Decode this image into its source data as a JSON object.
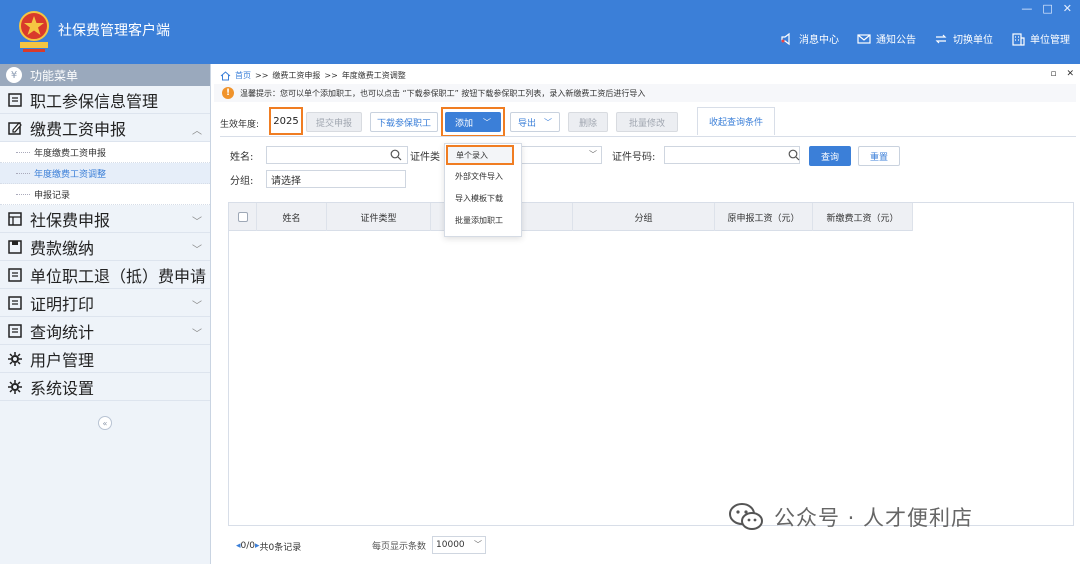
{
  "app": {
    "title": "社保费管理客户端"
  },
  "window_controls": [
    "—",
    "□",
    "✕"
  ],
  "top_nav": [
    {
      "label": "消息中心",
      "icon": "speaker-icon"
    },
    {
      "label": "通知公告",
      "icon": "mail-icon"
    },
    {
      "label": "切换单位",
      "icon": "switch-icon"
    },
    {
      "label": "单位管理",
      "icon": "building-icon"
    }
  ],
  "sidebar": {
    "header": "功能菜单",
    "items": [
      {
        "label": "职工参保信息管理",
        "icon": "list-icon"
      },
      {
        "label": "缴费工资申报",
        "icon": "edit-icon",
        "expanded": true,
        "children": [
          {
            "label": "年度缴费工资申报"
          },
          {
            "label": "年度缴费工资调整",
            "active": true
          },
          {
            "label": "申报记录"
          }
        ]
      },
      {
        "label": "社保费申报",
        "icon": "table-icon"
      },
      {
        "label": "费款缴纳",
        "icon": "save-icon"
      },
      {
        "label": "单位职工退（抵）费申请",
        "icon": "list-icon"
      },
      {
        "label": "证明打印",
        "icon": "list-icon"
      },
      {
        "label": "查询统计",
        "icon": "list-icon"
      },
      {
        "label": "用户管理",
        "icon": "gear-icon"
      },
      {
        "label": "系统设置",
        "icon": "gear-icon"
      }
    ]
  },
  "breadcrumb": [
    "首页",
    ">>",
    "缴费工资申报",
    ">>",
    "年度缴费工资调整"
  ],
  "notice": "温馨提示：您可以单个添加职工，也可以点击 “下载参保职工” 按钮下载参保职工列表，录入新缴费工资后进行导入",
  "toolbar": {
    "year_label": "生效年度:",
    "year_value": "2025",
    "submit": "提交申报",
    "download": "下载参保职工",
    "add": "添加",
    "export": "导出",
    "delete": "删除",
    "batch_edit": "批量修改",
    "collapse_query": "收起查询条件"
  },
  "add_menu": [
    "单个录入",
    "外部文件导入",
    "导入模板下载",
    "批量添加职工"
  ],
  "search": {
    "name_label": "姓名:",
    "name_value": "",
    "idtype_label": "证件类",
    "idno_label": "证件号码:",
    "idno_value": "",
    "group_label": "分组:",
    "group_value": "请选择",
    "query": "查询",
    "reset": "重置"
  },
  "table": {
    "columns": [
      "姓名",
      "证件类型",
      "",
      "分组",
      "原申报工资（元）",
      "新缴费工资（元）"
    ],
    "rows": []
  },
  "pager": {
    "page": "0/0",
    "total": "共0条记录",
    "per_page_label": "每页显示条数",
    "per_page_value": "10000"
  },
  "watermark": "公众号 · 人才便利店",
  "colors": {
    "header": "#3b7fd8",
    "highlight": "#f07d22",
    "primary": "#3b7fd8"
  }
}
